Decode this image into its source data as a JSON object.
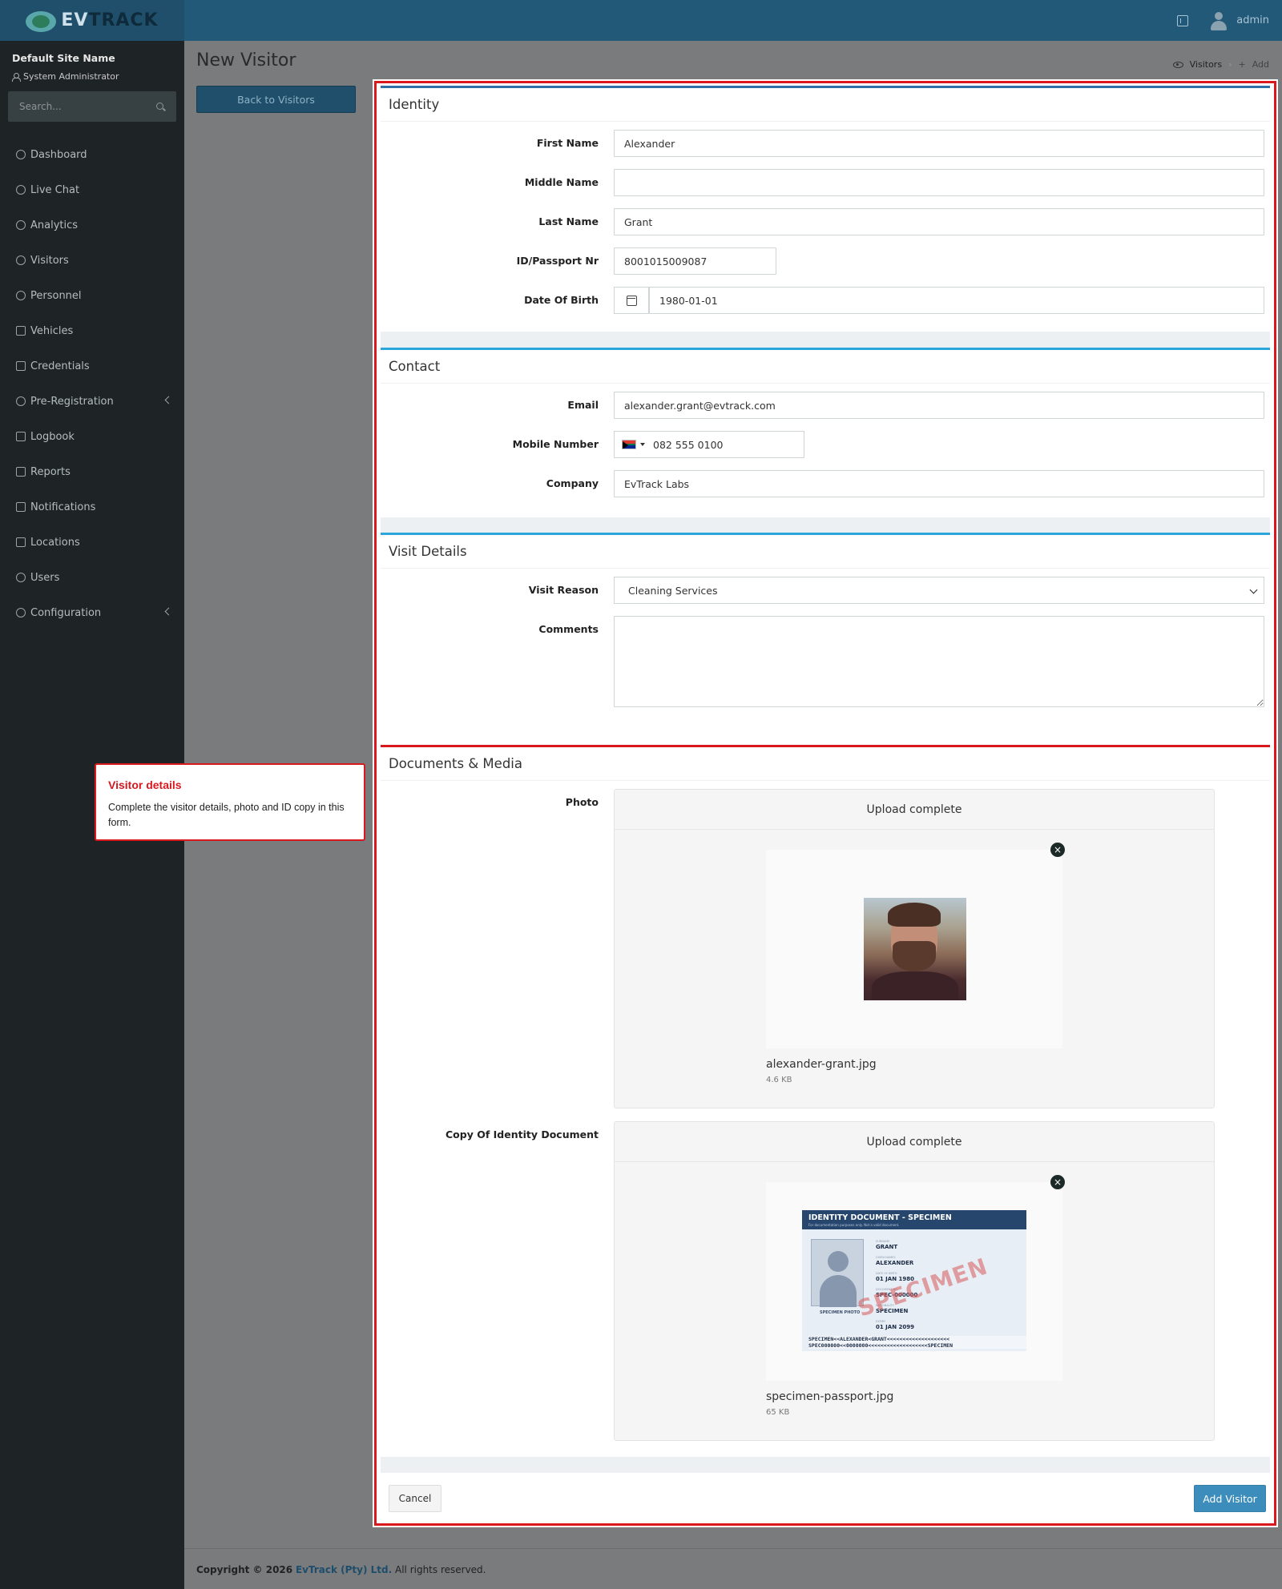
{
  "brand": {
    "logo_prefix": "EV",
    "logo_suffix": "TRACK"
  },
  "topbar": {
    "user": "admin"
  },
  "sidebar": {
    "site_name": "Default Site Name",
    "role": "System Administrator",
    "search_placeholder": "Search...",
    "items": [
      {
        "label": "Dashboard",
        "icon": "dashboard-icon"
      },
      {
        "label": "Live Chat",
        "icon": "headset-icon"
      },
      {
        "label": "Analytics",
        "icon": "analytics-icon"
      },
      {
        "label": "Visitors",
        "icon": "eye-icon"
      },
      {
        "label": "Personnel",
        "icon": "personnel-icon"
      },
      {
        "label": "Vehicles",
        "icon": "car-icon"
      },
      {
        "label": "Credentials",
        "icon": "badge-icon"
      },
      {
        "label": "Pre-Registration",
        "icon": "exchange-icon",
        "expandable": true
      },
      {
        "label": "Logbook",
        "icon": "book-icon"
      },
      {
        "label": "Reports",
        "icon": "reports-icon"
      },
      {
        "label": "Notifications",
        "icon": "notifications-icon"
      },
      {
        "label": "Locations",
        "icon": "building-icon"
      },
      {
        "label": "Users",
        "icon": "users-icon"
      },
      {
        "label": "Configuration",
        "icon": "gear-icon",
        "expandable": true
      }
    ]
  },
  "page": {
    "title": "New Visitor",
    "back_label": "Back to Visitors",
    "breadcrumb": {
      "visitors": "Visitors",
      "add": "Add"
    }
  },
  "identity": {
    "title": "Identity",
    "first_name_label": "First Name",
    "first_name": "Alexander",
    "middle_name_label": "Middle Name",
    "middle_name": "",
    "last_name_label": "Last Name",
    "last_name": "Grant",
    "id_label": "ID/Passport Nr",
    "id_value": "8001015009087",
    "dob_label": "Date Of Birth",
    "dob": "1980-01-01"
  },
  "contact": {
    "title": "Contact",
    "email_label": "Email",
    "email": "alexander.grant@evtrack.com",
    "mobile_label": "Mobile Number",
    "mobile": "082 555 0100",
    "company_label": "Company",
    "company": "EvTrack Labs"
  },
  "visit": {
    "title": "Visit Details",
    "reason_label": "Visit Reason",
    "reason": "Cleaning Services",
    "comments_label": "Comments",
    "comments": ""
  },
  "documents": {
    "title": "Documents & Media",
    "photo_label": "Photo",
    "photo_status": "Upload complete",
    "photo_file": "alexander-grant.jpg",
    "photo_size": "4.6 KB",
    "id_doc_label": "Copy Of Identity Document",
    "id_status": "Upload complete",
    "id_file": "specimen-passport.jpg",
    "id_size": "65 KB",
    "specimen": {
      "header": "IDENTITY DOCUMENT - SPECIMEN",
      "subheader": "For documentation purposes only. Not a valid document.",
      "photo_caption": "SPECIMEN PHOTO",
      "surname_label": "SURNAME",
      "surname": "GRANT",
      "given_label": "GIVEN NAMES",
      "given": "ALEXANDER",
      "dob_label": "DATE OF BIRTH",
      "dob": "01 JAN 1980",
      "docno_label": "DOCUMENT NO",
      "docno": "SPEC-000000",
      "nationality_label": "NATIONALITY",
      "nationality": "SPECIMEN",
      "expiry_label": "EXPIRY",
      "expiry": "01 JAN 2099",
      "stamp": "SPECIMEN",
      "mrz1": "SPECIMEN<<ALEXANDER<GRANT<<<<<<<<<<<<<<<<<<<<",
      "mrz2": "SPEC000000<<0000000<<<<<<<<<<<<<<<<<<<SPECIMEN"
    }
  },
  "actions": {
    "cancel": "Cancel",
    "submit": "Add Visitor"
  },
  "tooltip": {
    "title": "Visitor details",
    "body": "Complete the visitor details, photo and ID copy in this form."
  },
  "footer": {
    "copyright": "Copyright © 2026",
    "company": "EvTrack (Pty) Ltd.",
    "rights": "All rights reserved."
  }
}
